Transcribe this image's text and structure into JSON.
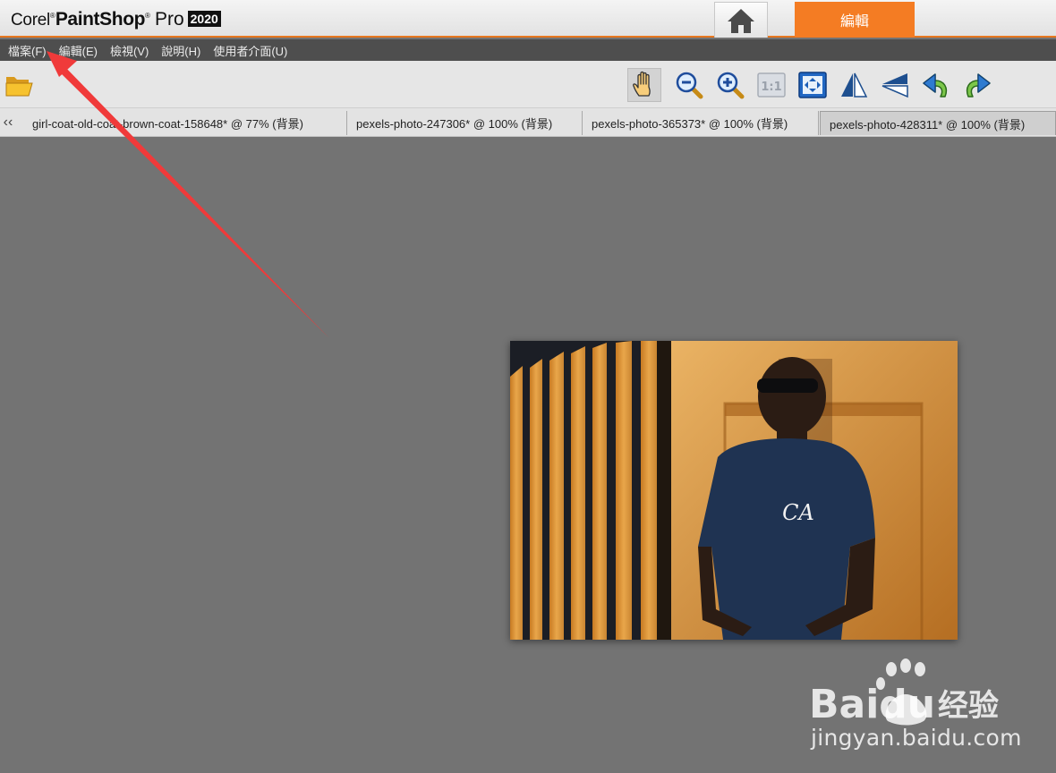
{
  "app": {
    "brand_corel": "Corel",
    "brand_paintshop": "PaintShop",
    "brand_pro": "Pro",
    "brand_year": "2020",
    "reg_mark": "®",
    "edit_tab": "編輯",
    "accent": "#f47c23"
  },
  "menu": [
    {
      "label": "檔案(F)"
    },
    {
      "label": "編輯(E)"
    },
    {
      "label": "檢視(V)"
    },
    {
      "label": "說明(H)"
    },
    {
      "label": "使用者介面(U)"
    }
  ],
  "toolbar": {
    "icons": [
      "open-folder-icon",
      "pan-hand-icon",
      "zoom-out-icon",
      "zoom-in-icon",
      "actual-size-icon",
      "fit-window-icon",
      "flip-icon",
      "mirror-icon",
      "undo-icon",
      "redo-icon"
    ],
    "actual_size_label": "1:1",
    "active_tool": "pan-hand-icon"
  },
  "tabs": [
    {
      "label": "girl-coat-old-coat-brown-coat-158648* @  77% (背景)",
      "active": false
    },
    {
      "label": "pexels-photo-247306* @ 100% (背景)",
      "active": false
    },
    {
      "label": "pexels-photo-365373* @ 100% (背景)",
      "active": false
    },
    {
      "label": "pexels-photo-428311* @ 100% (背景)",
      "active": true
    }
  ],
  "photo": {
    "shirt_text": "CA"
  },
  "watermark": {
    "brand": "Baidu",
    "brand_cn": "经验",
    "url": "jingyan.baidu.com"
  },
  "annotation_color": "#f03a3a"
}
